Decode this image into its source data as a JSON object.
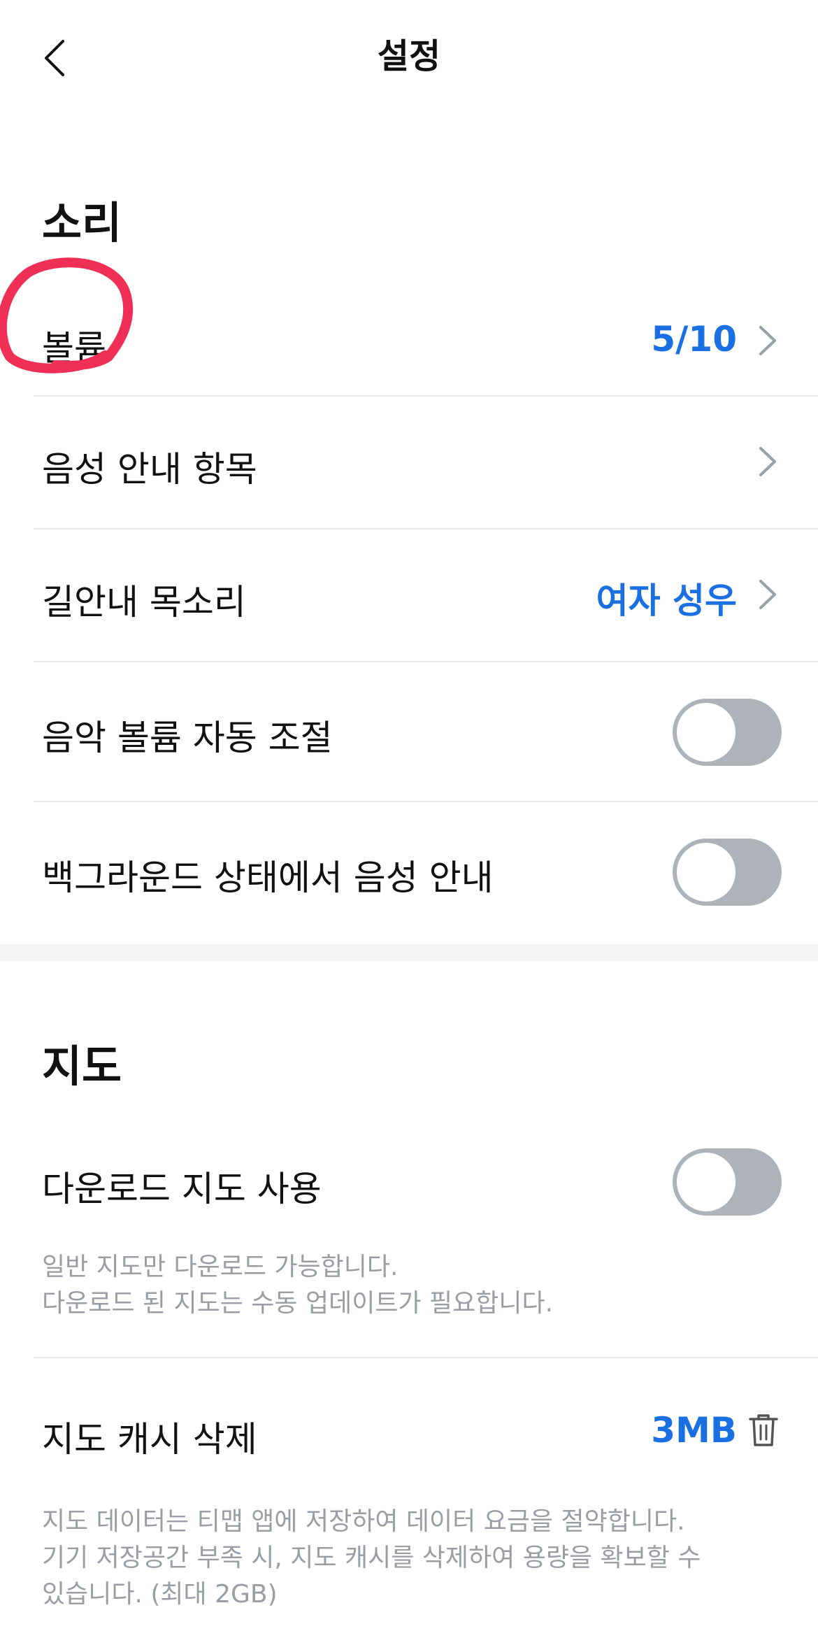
{
  "header": {
    "title": "설정",
    "back_icon": "chevron-left-icon"
  },
  "sound": {
    "title": "소리",
    "volume": {
      "label": "볼륨",
      "value": "5/10"
    },
    "voice_items": {
      "label": "음성 안내 항목"
    },
    "nav_voice": {
      "label": "길안내 목소리",
      "value": "여자 성우"
    },
    "music_auto": {
      "label": "음악 볼륨 자동 조절",
      "on": false
    },
    "background_voice": {
      "label": "백그라운드 상태에서 음성 안내",
      "on": false
    }
  },
  "map": {
    "title": "지도",
    "download": {
      "label": "다운로드 지도 사용",
      "on": false,
      "help": [
        "일반 지도만 다운로드 가능합니다.",
        "다운로드 된 지도는 수동 업데이트가 필요합니다."
      ]
    },
    "cache": {
      "label": "지도 캐시 삭제",
      "value": "3MB",
      "icon": "trash-icon",
      "help": [
        "지도 데이터는 티맵 앱에 저장하여 데이터 요금을 절약합니다.",
        "기기 저장공간 부족 시, 지도 캐시를 삭제하여 용량을 확보할 수",
        "있습니다. (최대 2GB)"
      ]
    }
  },
  "colors": {
    "accent": "#1a6fe3",
    "toggle_off": "#aeb3ba",
    "annotation": "#ef2f55"
  }
}
